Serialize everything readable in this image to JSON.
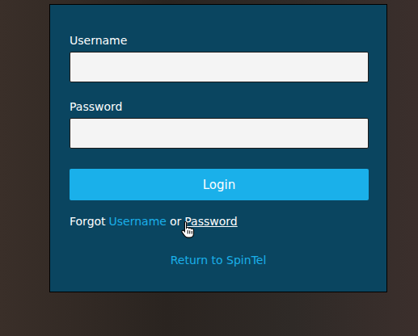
{
  "form": {
    "fields": [
      {
        "label": "Username",
        "value": "",
        "type": "text"
      },
      {
        "label": "Password",
        "value": "",
        "type": "password"
      }
    ],
    "submit": "Login",
    "forgot": {
      "prefix": "Forgot",
      "separator": "or",
      "links": [
        {
          "label": "Username",
          "hovered": false
        },
        {
          "label": "Password",
          "hovered": true
        }
      ]
    },
    "return_link": "Return to SpinTel"
  }
}
